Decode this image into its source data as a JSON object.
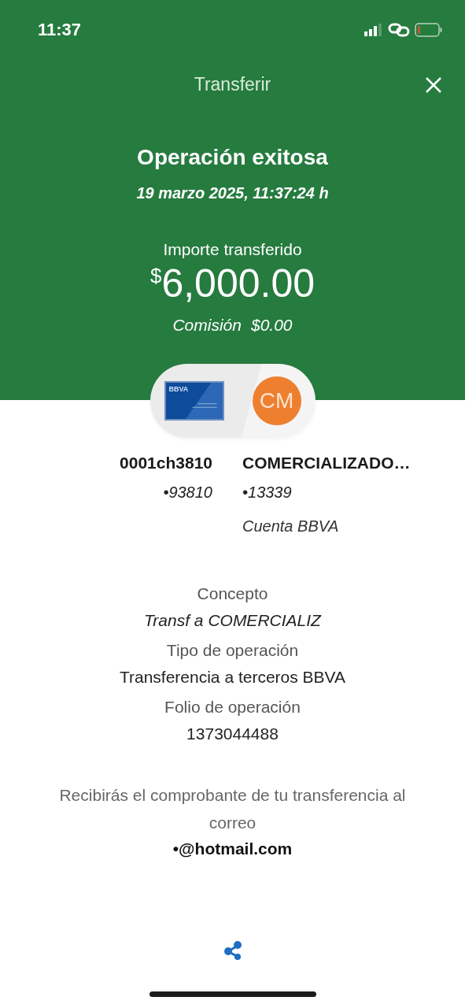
{
  "status_bar": {
    "time": "11:37"
  },
  "header": {
    "title": "Transferir"
  },
  "result": {
    "title": "Operación exitosa",
    "datetime": "19 marzo 2025, 11:37:24 h",
    "amount_label": "Importe transferido",
    "currency": "$",
    "amount": "6,000.00",
    "commission_label": "Comisión",
    "commission": "$0.00"
  },
  "origin": {
    "logo_text": "BBVA",
    "name": "0001ch3810",
    "account": "•93810"
  },
  "destination": {
    "initials": "CM",
    "name": "COMERCIALIZADO…",
    "account": "•13339",
    "bank": "Cuenta BBVA"
  },
  "details": [
    {
      "label": "Concepto",
      "value": "Transf a COMERCIALIZ",
      "kind": "concept"
    },
    {
      "label": "Tipo de operación",
      "value": "Transferencia a terceros BBVA",
      "kind": "info"
    },
    {
      "label": "Folio de operación",
      "value": "1373044488",
      "kind": "info"
    }
  ],
  "notice": {
    "text": "Recibirás el comprobante de tu transferencia al correo",
    "email": "•@hotmail.com"
  }
}
